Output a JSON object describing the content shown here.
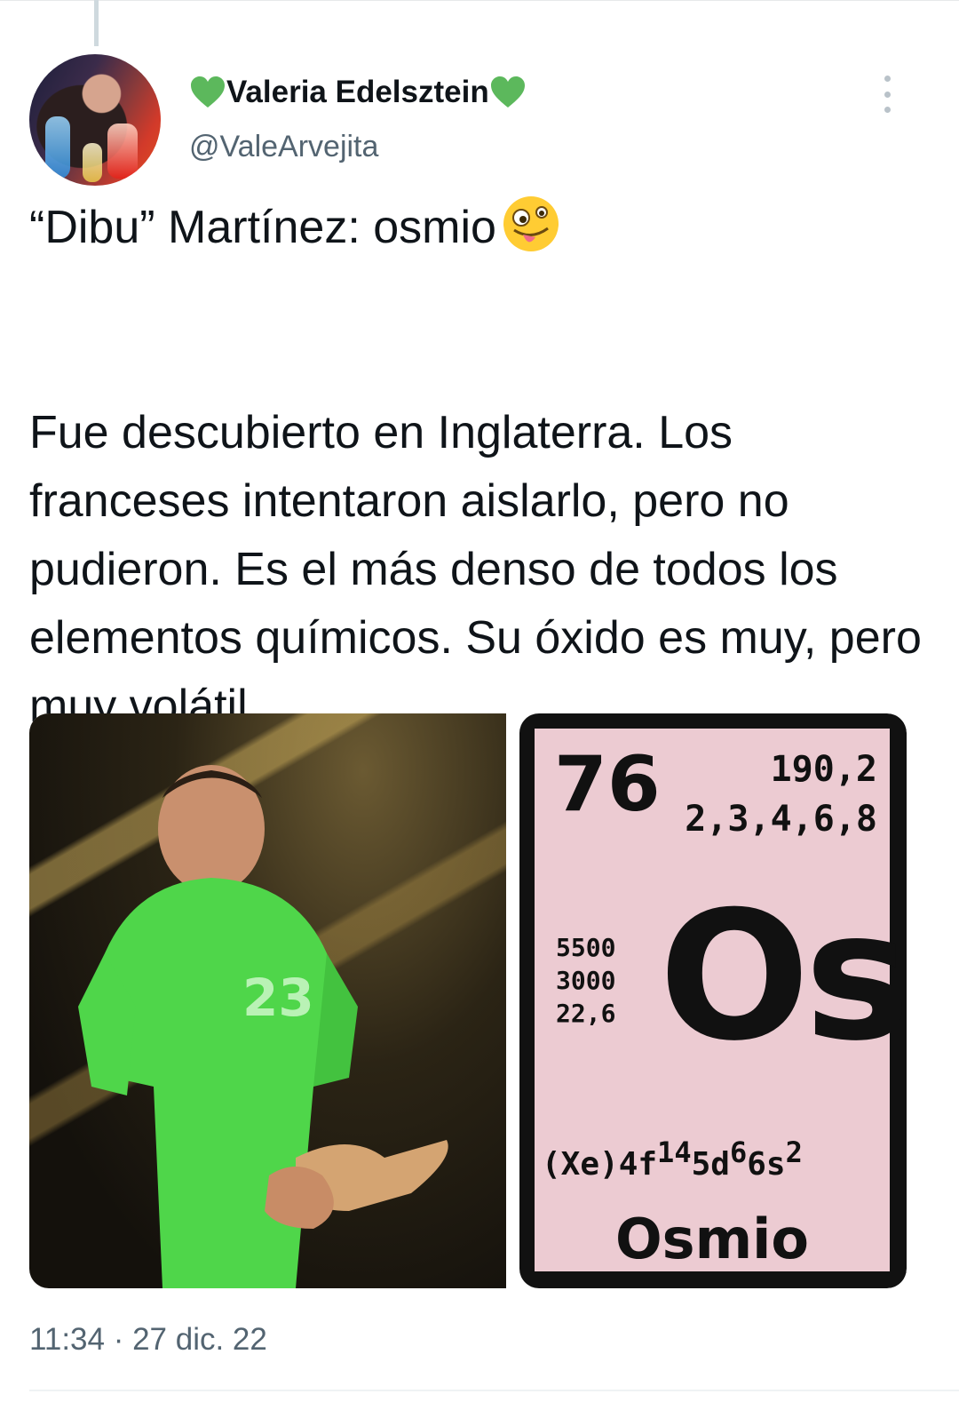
{
  "tweet": {
    "author": {
      "display_name": "Valeria Edelsztein",
      "handle": "@ValeArvejita",
      "name_decoration": "green-heart-emoji"
    },
    "text_line1": "“Dibu” Martínez: osmio",
    "text_line1_emoji": "zany-face-emoji",
    "text_body": "Fue descubierto en Inglaterra. Los franceses intentaron aislarlo, pero no pudieron. Es el más denso de todos los elementos químicos. Su óxido es muy, pero muy volátil.",
    "timestamp": "11:34 · 27 dic. 22",
    "more_icon": "more-vertical-icon"
  },
  "media": {
    "photo": "goalkeeper-photo",
    "element_card": {
      "atomic_number": "76",
      "atomic_mass": "190,2",
      "oxidation_states": "2,3,4,6,8",
      "boiling_point": "5500",
      "melting_point": "3000",
      "density": "22,6",
      "symbol": "Os",
      "config_base": "(Xe)4f",
      "config_sup1": "14",
      "config_mid": "5d",
      "config_sup2": "6",
      "config_end": "6s",
      "config_sup3": "2",
      "name": "Osmio",
      "background_color": "#eccbd2"
    }
  },
  "colors": {
    "text": "#0f1419",
    "secondary": "#536471",
    "heart": "#5cb85c"
  }
}
